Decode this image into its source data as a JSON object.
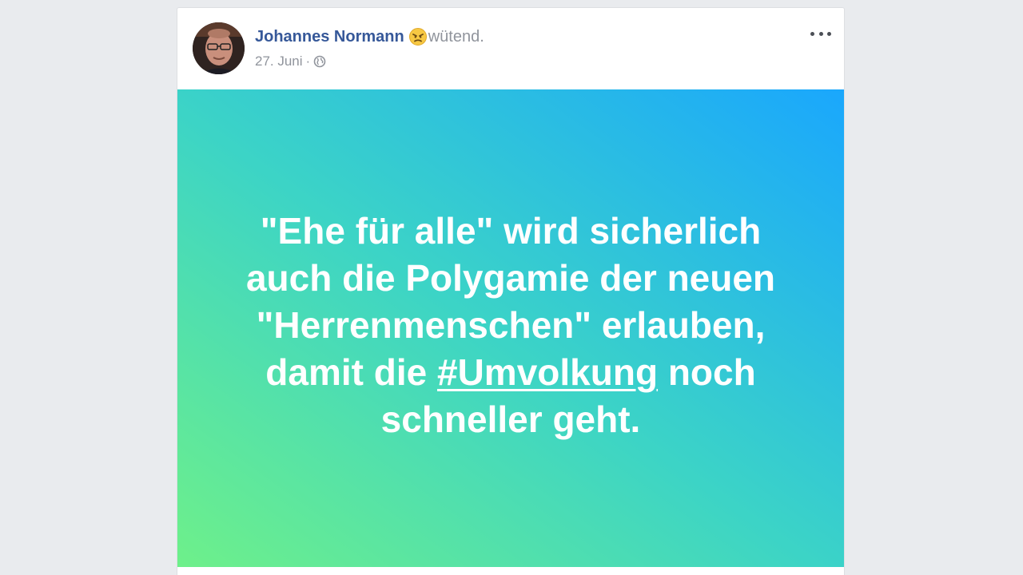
{
  "post": {
    "author": "Johannes Normann",
    "feeling_text": "wütend.",
    "feeling_icon": "angry-face-icon",
    "date": "27. Juni",
    "separator": "·",
    "privacy_icon": "globe-icon",
    "more_icon": "more-options-icon",
    "body": {
      "line1": "\"Ehe für alle\" wird sicherlich",
      "line2": "auch die Polygamie der neuen",
      "line3": "\"Herrenmenschen\" erlauben,",
      "line4_before": "damit die ",
      "hashtag": "#Umvolkung",
      "line4_after": " noch",
      "line5": "schneller geht."
    },
    "colors": {
      "author": "#365899",
      "meta": "#90949c",
      "gradient_start": "#6ef08a",
      "gradient_mid": "#3cd4c6",
      "gradient_end": "#1aa7fd",
      "page_background": "#e9ebee"
    }
  }
}
